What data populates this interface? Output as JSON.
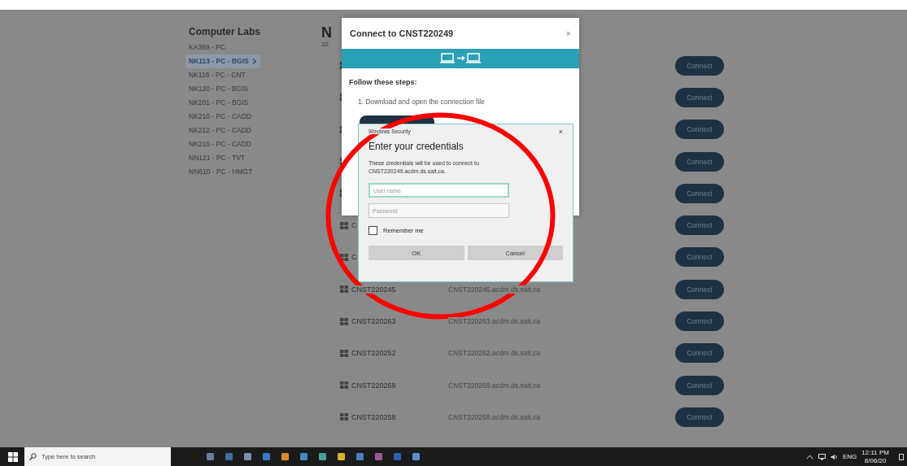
{
  "sidebar": {
    "title": "Computer Labs",
    "items": [
      {
        "label": "KA389 - PC",
        "selected": false
      },
      {
        "label": "NK113 - PC - BGIS",
        "selected": true
      },
      {
        "label": "NK116 - PC - CNT",
        "selected": false
      },
      {
        "label": "NK120 - PC - BGIS",
        "selected": false
      },
      {
        "label": "NK201 - PC - BGIS",
        "selected": false
      },
      {
        "label": "NK210 - PC - CADD",
        "selected": false
      },
      {
        "label": "NK212 - PC - CADD",
        "selected": false
      },
      {
        "label": "NK216 - PC - CADD",
        "selected": false
      },
      {
        "label": "NN121 - PC - TVT",
        "selected": false
      },
      {
        "label": "NN610 - PC - HMGT",
        "selected": false
      }
    ]
  },
  "main": {
    "heading": "N",
    "subtitle": "32",
    "rows": [
      {
        "button": "Connect"
      },
      {
        "button": "Connect"
      },
      {
        "button": "Connect"
      },
      {
        "button": "Connect"
      },
      {
        "button": "Connect"
      },
      {
        "name": "C",
        "button": "Connect"
      },
      {
        "name": "C",
        "button": "Connect"
      },
      {
        "name": "CNST220245",
        "address": "CNST220245.acdm.ds.sait.ca",
        "button": "Connect"
      },
      {
        "name": "CNST220263",
        "address": "CNST220263.acdm.ds.sait.ca",
        "button": "Connect"
      },
      {
        "name": "CNST220252",
        "address": "CNST220252.acdm.ds.sait.ca",
        "button": "Connect"
      },
      {
        "name": "CNST220269",
        "address": "CNST220269.acdm.ds.sait.ca",
        "button": "Connect"
      },
      {
        "name": "CNST220258",
        "address": "CNST220258.acdm.ds.sait.ca",
        "button": "Connect"
      }
    ]
  },
  "connect_dialog": {
    "title": "Connect to CNST220249",
    "close": "×",
    "steps_heading": "Follow these steps:",
    "steps": [
      "1. Download and open the connection file"
    ]
  },
  "security_dialog": {
    "window_title": "Windows Security",
    "close": "×",
    "heading": "Enter your credentials",
    "message": "These credentials will be used to connect to CNST220249.acdm.ds.sait.ca.",
    "username": {
      "placeholder": "User name"
    },
    "password": {
      "placeholder": "Password"
    },
    "remember": {
      "label": "Remember me",
      "checked": false
    },
    "buttons": [
      "OK",
      "Cancel"
    ]
  },
  "taskbar": {
    "search": {
      "placeholder": "Type here to search"
    },
    "language": "ENG",
    "time": "12:11 PM",
    "date": "8/06/20"
  }
}
